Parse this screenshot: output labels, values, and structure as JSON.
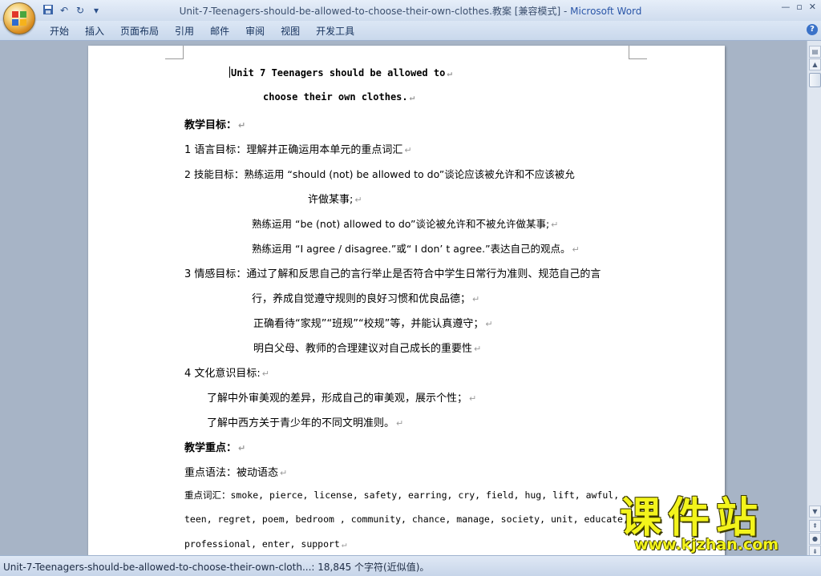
{
  "window": {
    "doc_title": "Unit-7-Teenagers-should-be-allowed-to-choose-their-own-clothes.教案 [兼容模式]",
    "separator": " - ",
    "app_name": "Microsoft Word"
  },
  "quick_access": {
    "save_icon": "save-icon",
    "undo_icon": "undo-icon",
    "redo_icon": "redo-icon",
    "customize_icon": "dropdown-icon"
  },
  "ribbon": {
    "tabs": [
      "开始",
      "插入",
      "页面布局",
      "引用",
      "邮件",
      "审阅",
      "视图",
      "开发工具"
    ]
  },
  "document": {
    "title_line1": "Unit 7 Teenagers should be allowed to",
    "title_line2": "choose their own clothes.",
    "lines": [
      "教学目标：",
      "1 语言目标：理解并正确运用本单元的重点词汇",
      "2 技能目标：熟练运用 “should (not) be allowed to do”谈论应该被允许和不应该被允",
      "许做某事;",
      "熟练运用 “be (not) allowed to do”谈论被允许和不被允许做某事;",
      "熟练运用 “I agree / disagree.”或“ I don’ t agree.”表达自己的观点。",
      "3 情感目标：通过了解和反思自己的言行举止是否符合中学生日常行为准则、规范自己的言",
      "行，养成自觉遵守规则的良好习惯和优良品德；",
      "正确看待“家规”“班规”“校规”等，并能认真遵守；",
      "明白父母、教师的合理建议对自己成长的重要性",
      "4 文化意识目标:",
      "了解中外审美观的差异，形成自己的审美观，展示个性；",
      "了解中西方关于青少年的不同文明准则。",
      "教学重点：",
      "重点语法：被动语态",
      "重点词汇：smoke, pierce, license, safety, earring, cry, field, hug, lift, awful,",
      "teen, regret, poem, bedroom , community, chance, manage, society, unit, educate,",
      "professional, enter, support"
    ]
  },
  "status": {
    "text": "Unit-7-Teenagers-should-be-allowed-to-choose-their-own-cloth...: 18,845 个字符(近似值)。"
  },
  "watermark": {
    "big": "课件站",
    "url": "www.kjzhan.com"
  }
}
